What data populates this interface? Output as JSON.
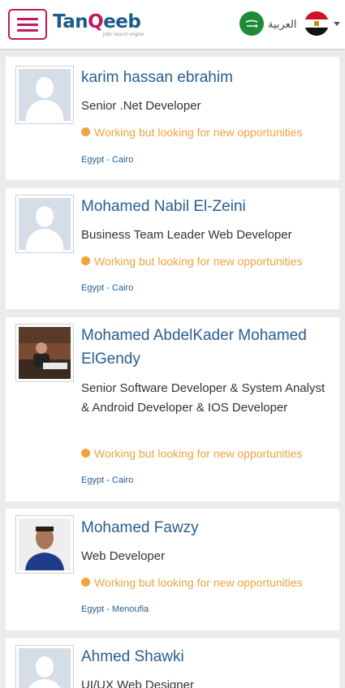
{
  "header": {
    "logo_main": "Tan",
    "logo_accent": "Q",
    "logo_rest": "eeb",
    "logo_tagline": "jobs search engine",
    "language_label": "العربية",
    "country_flag": "egypt-flag-icon",
    "brand_color": "#c2185b",
    "primary_color": "#2a5d8f"
  },
  "profiles": [
    {
      "name": "karim hassan ebrahim",
      "job_title": "Senior .Net Developer",
      "status": "Working but looking for new opportunities",
      "location": "Egypt - Cairo"
    },
    {
      "name": "Mohamed Nabil El-Zeini",
      "job_title": "Business Team Leader Web Developer",
      "status": "Working but looking for new opportunities",
      "location": "Egypt - Cairo"
    },
    {
      "name": "Mohamed AbdelKader Mohamed ElGendy",
      "job_title": "Senior Software Developer & System Analyst & Android Developer & IOS Developer",
      "status": "Working but looking for new opportunities",
      "location": "Egypt - Cairo"
    },
    {
      "name": "Mohamed Fawzy",
      "job_title": "Web Developer",
      "status": "Working but looking for new opportunities",
      "location": "Egypt - Menoufia"
    },
    {
      "name": "Ahmed Shawki",
      "job_title": "UI/UX Web Designer"
    }
  ]
}
